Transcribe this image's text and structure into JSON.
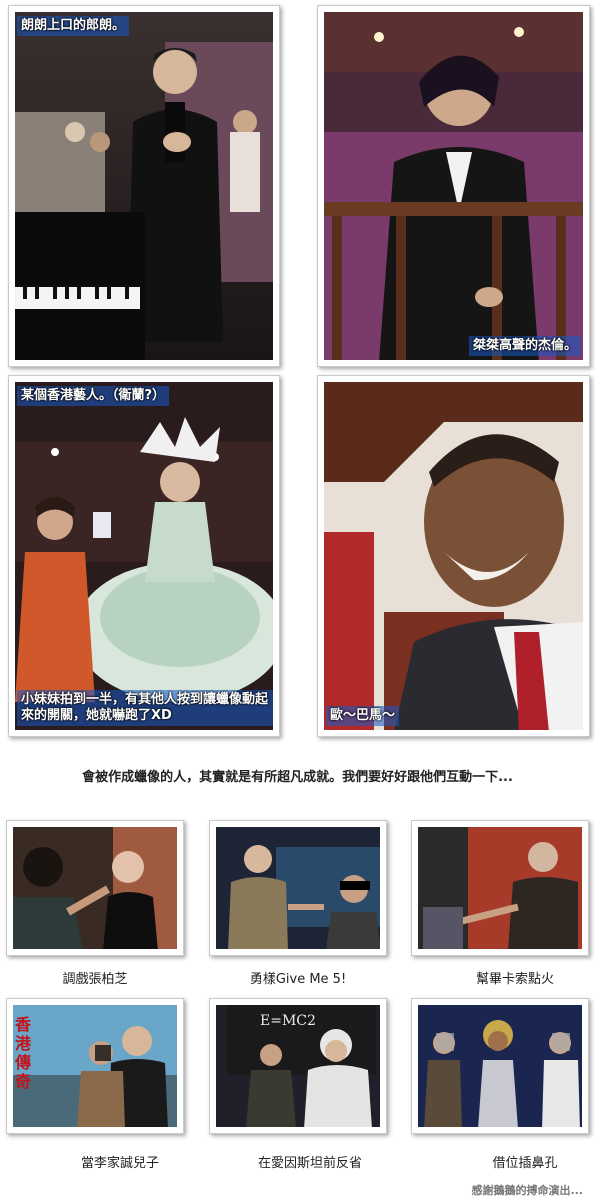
{
  "large_photos": [
    {
      "caption": "朗朗上口的郎朗。",
      "subject": "piano-performer-figure"
    },
    {
      "caption": "桀桀高聲的杰倫。",
      "subject": "singer-figure"
    },
    {
      "caption": "某個香港藝人。（衛蘭?）",
      "caption_bottom": "小妹妹拍到一半，有其他人按到讓蠟像動起來的開關，她就嚇跑了XD",
      "subject": "ballgown-figure"
    },
    {
      "caption": "歐～巴馬～",
      "subject": "smiling-statesman-figure"
    }
  ],
  "mid_text": "會被作成蠟像的人，其實就是有所超凡成就。我們要好好跟他們互動一下...",
  "thumbs": [
    {
      "caption": "調戲張柏芝"
    },
    {
      "caption": "勇樣Give Me 5!"
    },
    {
      "caption": "幫畢卡索點火"
    },
    {
      "caption": "當李家誠兒子",
      "poster_text": "香港傳奇"
    },
    {
      "caption": "在愛因斯坦前反省",
      "board_text": "E=MC2"
    },
    {
      "caption": "借位插鼻孔"
    }
  ],
  "footer": "感謝鵝鵝的搏命演出...",
  "colors": {
    "caption_bg": "#2a6fd6",
    "poster_red": "#c0151c"
  }
}
